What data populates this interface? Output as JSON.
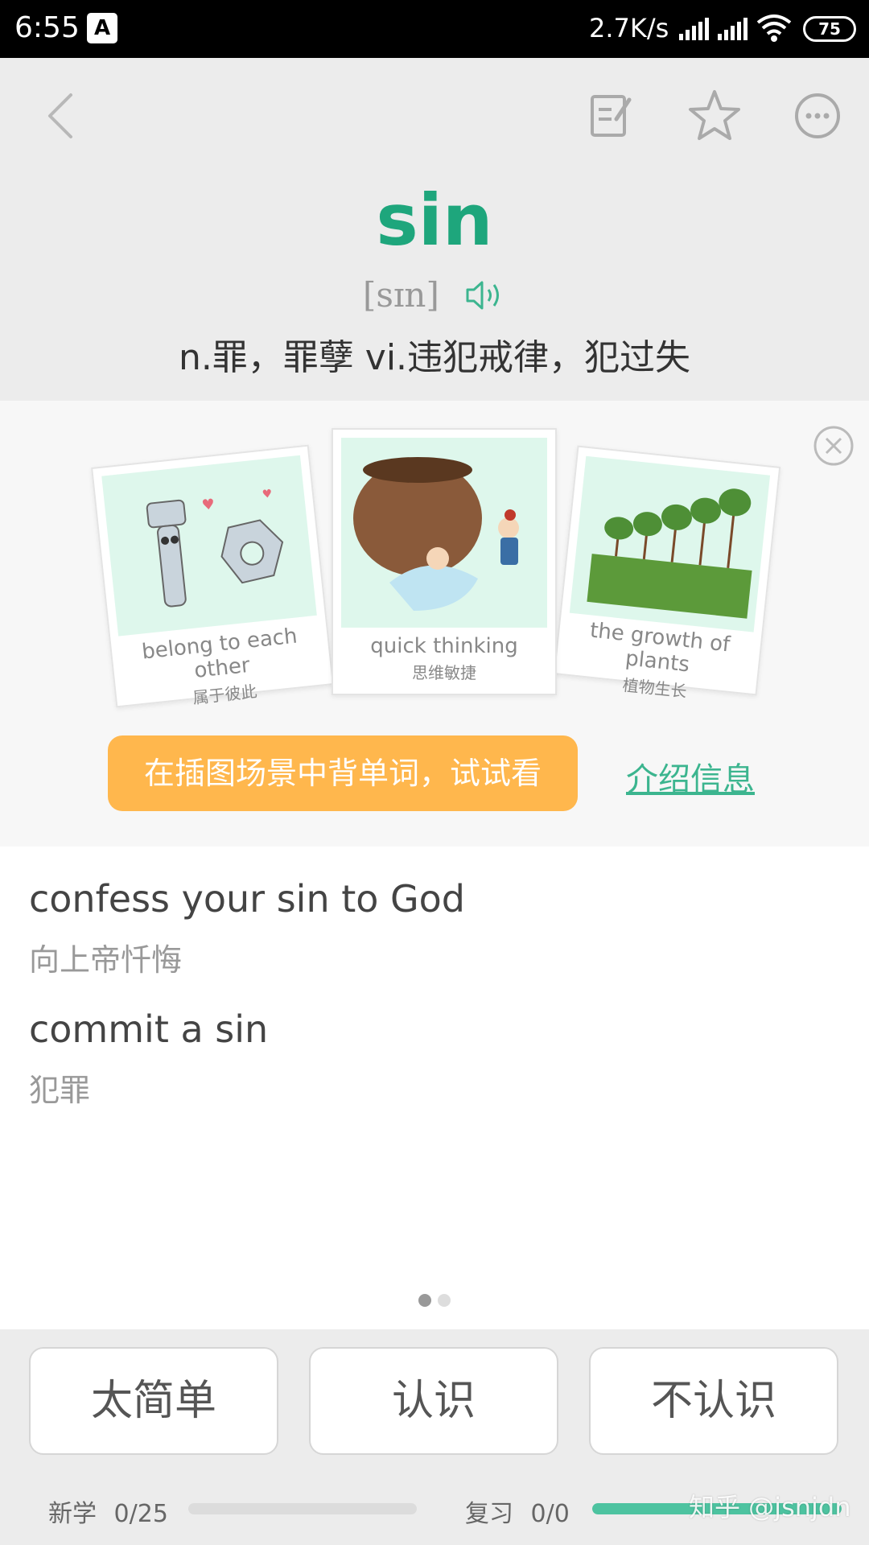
{
  "status_bar": {
    "time": "6:55",
    "app_badge": "A",
    "net_speed": "2.7K/s",
    "battery": "75"
  },
  "toolbar": {
    "icons": [
      "back-icon",
      "note-icon",
      "star-icon",
      "more-icon"
    ]
  },
  "word": {
    "text": "sin",
    "phonetic": "[sɪn]",
    "definition": "n.罪，罪孽 vi.违犯戒律，犯过失",
    "accent_color": "#1ea67c"
  },
  "illustrations": {
    "cards": [
      {
        "caption_en": "belong to each other",
        "caption_zh": "属于彼此"
      },
      {
        "caption_en": "quick thinking",
        "caption_zh": "思维敏捷"
      },
      {
        "caption_en": "the growth of plants",
        "caption_zh": "植物生长"
      }
    ],
    "try_button": "在插图场景中背单词，试试看",
    "intro_link": "介绍信息",
    "button_color": "#ffb74d"
  },
  "examples": [
    {
      "en": "confess your sin to God",
      "zh": "向上帝忏悔"
    },
    {
      "en": "commit a sin",
      "zh": "犯罪"
    }
  ],
  "pager": {
    "page": 1,
    "total": 2
  },
  "answer_buttons": [
    "太简单",
    "认识",
    "不认识"
  ],
  "progress": {
    "new_label": "新学",
    "new_count": "0/25",
    "new_fraction": 0.0,
    "review_label": "复习",
    "review_count": "0/0",
    "review_fraction": 1.0,
    "fill_color": "#4dc3a0"
  },
  "watermark": "知乎 @jsnjdn"
}
